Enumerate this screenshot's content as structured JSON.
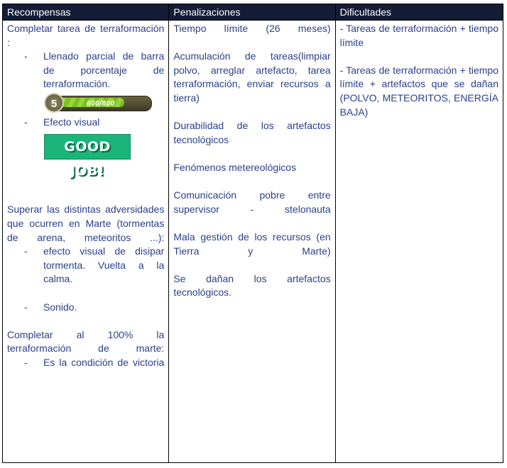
{
  "headers": [
    "Recompensas",
    "Penalizaciones",
    "Dificultades"
  ],
  "rewards": {
    "item1_text": "Completar tarea de terraformación :",
    "item1_bullet1": "Llenado parcial de barra de porcentaje de terraformación.",
    "progress": {
      "level": "5",
      "value_text": "600/800",
      "fill_fraction": 0.75
    },
    "item1_bullet2": "Efecto visual",
    "good_job_label": "GOOD JOB!",
    "item2_text": "Superar las distintas adversidades que ocurren en Marte (tormentas de arena, meteoritos ...):",
    "item2_bullet1": "efecto visual de disipar tormenta. Vuelta a la calma.",
    "item2_bullet2": "Sonido.",
    "item3_text": "Completar al 100% la terraformación de marte:",
    "item3_bullet1": "Es la condición de victoria"
  },
  "penalties": [
    "Tiempo límite (26 meses)",
    "Acumulación de tareas(limpiar polvo, arreglar artefacto, tarea terraformación, enviar recursos a tierra)",
    "Durabilidad de los artefactos tecnológicos",
    "Fenómenos metereológicos",
    "Comunicación pobre entre supervisor - stelonauta",
    "Mala gestión de los recursos (en Tierra y Marte)",
    "Se dañan los artefactos tecnológicos."
  ],
  "difficulties": [
    "- Tareas de terraformación + tiempo límite",
    "- Tareas de terraformación + tiempo límite + artefactos que se dañan (POLVO, METEORITOS, ENERGÍA BAJA)"
  ],
  "colors": {
    "header_bg": "#141c36",
    "body_text": "#2a3f8c",
    "good_job_bg": "#1bb47a"
  }
}
